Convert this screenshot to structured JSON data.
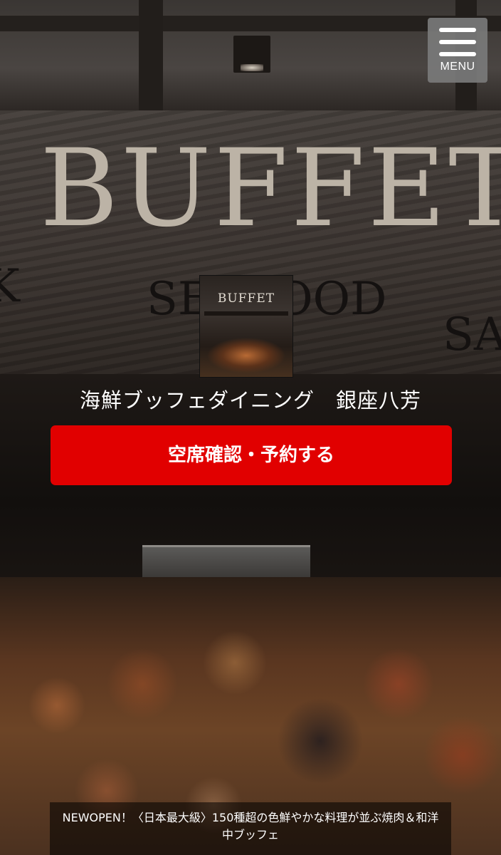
{
  "header": {
    "menu_label": "MENU",
    "menu_icon": "hamburger-icon"
  },
  "hero": {
    "sign_title": "BUFFET",
    "sign_sub_left": "SEAFOOD",
    "sign_sub_right": "SA",
    "logo_word": "BUFFET",
    "restaurant_name": "海鮮ブッフェダイニング　銀座八芳"
  },
  "cta": {
    "reserve_label": "空席確認・予約する",
    "color": "#e10000"
  },
  "news": {
    "text": "NEWOPEN！〈日本最大級〉150種超の色鮮やかな料理が並ぶ焼肉＆和洋中ブッフェ"
  }
}
